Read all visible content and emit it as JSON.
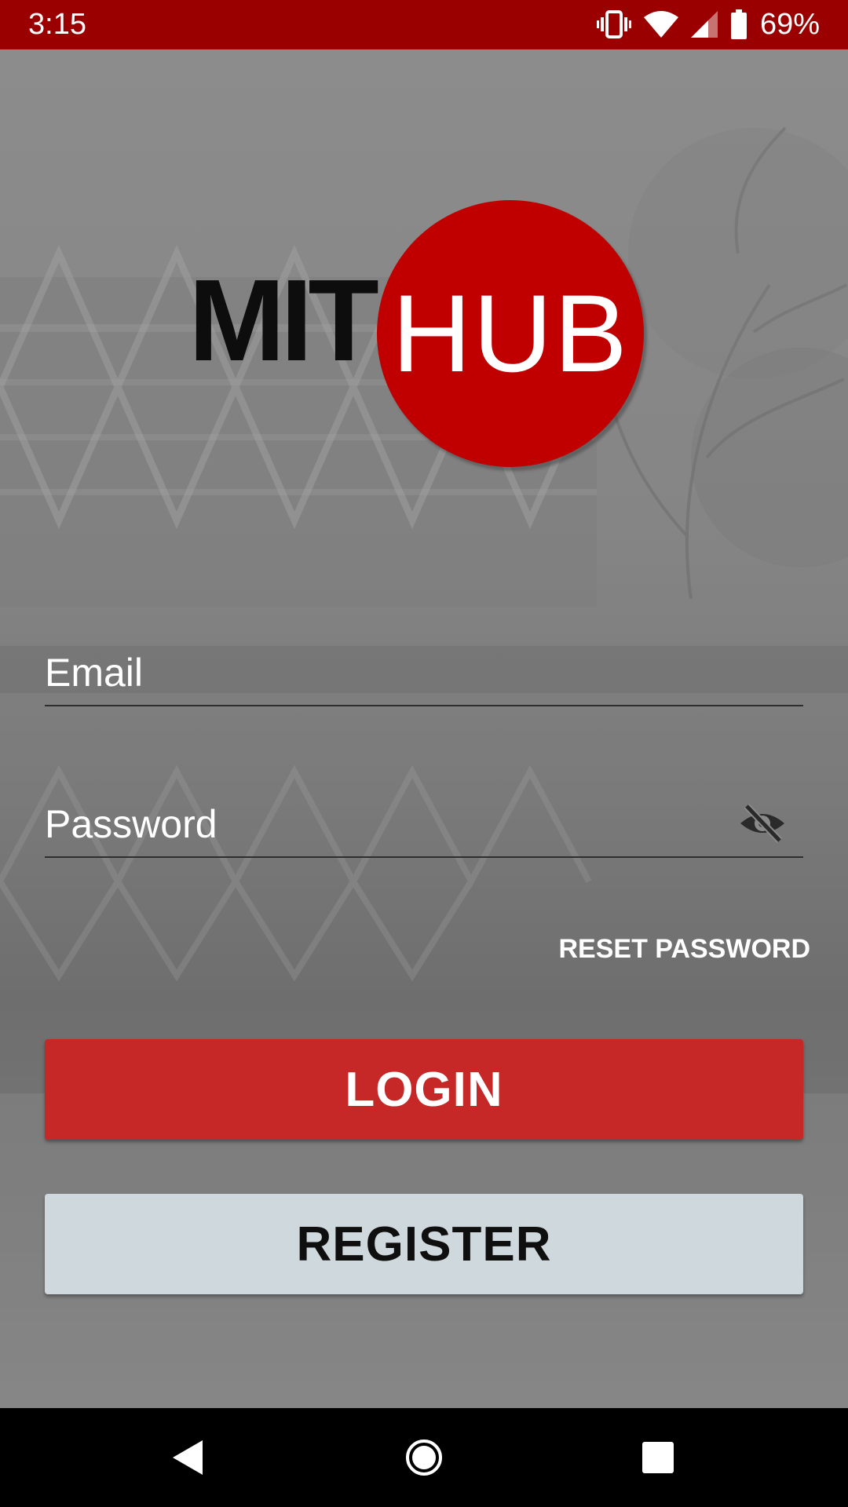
{
  "status_bar": {
    "time": "3:15",
    "battery_percent": "69%",
    "icons": [
      "vibrate-icon",
      "wifi-icon",
      "cellular-signal-icon",
      "battery-icon"
    ]
  },
  "logo": {
    "left_text": "MIT",
    "circle_text": "HUB",
    "circle_color": "#c00000"
  },
  "form": {
    "email_placeholder": "Email",
    "email_value": "",
    "password_placeholder": "Password",
    "password_value": "",
    "password_toggle_icon": "eye-off-icon",
    "reset_password_label": "RESET PASSWORD"
  },
  "buttons": {
    "login_label": "LOGIN",
    "login_color": "#c62828",
    "register_label": "REGISTER",
    "register_color": "#cfd8dc"
  },
  "nav_bar": {
    "icons": [
      "back-icon",
      "home-icon",
      "recents-icon"
    ]
  },
  "colors": {
    "status_bar": "#9a0000",
    "background": "#8a8a8a"
  }
}
